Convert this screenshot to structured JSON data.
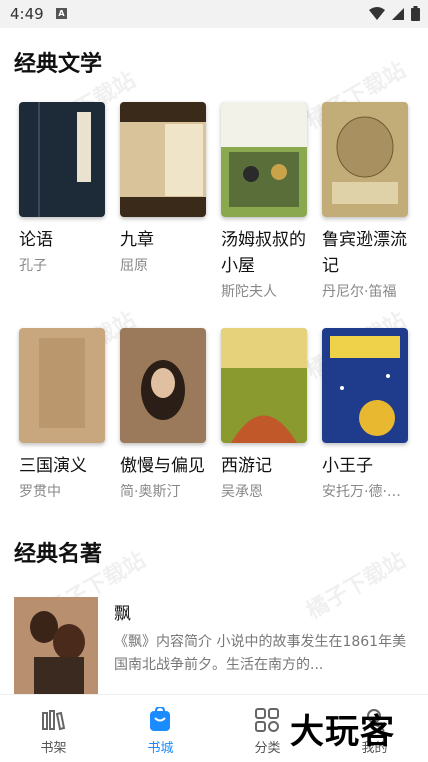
{
  "status": {
    "time": "4:49",
    "notif_icon": "A"
  },
  "sections": {
    "classic_lit": {
      "title": "经典文学"
    },
    "masterpieces": {
      "title": "经典名著"
    }
  },
  "books": [
    {
      "title": "论语",
      "author": "孔子",
      "cover_color": "#1d2a38"
    },
    {
      "title": "九章",
      "author": "屈原",
      "cover_color": "#c9a876"
    },
    {
      "title": "汤姆叔叔的小屋",
      "author": "斯陀夫人",
      "cover_color": "#6e8f3e"
    },
    {
      "title": "鲁宾逊漂流记",
      "author": "丹尼尔·笛福",
      "cover_color": "#b9a16c"
    },
    {
      "title": "三国演义",
      "author": "罗贯中",
      "cover_color": "#c4a27a"
    },
    {
      "title": "傲慢与偏见",
      "author": "简·奥斯汀",
      "cover_color": "#8a6a50"
    },
    {
      "title": "西游记",
      "author": "吴承恩",
      "cover_color": "#7b8a2a"
    },
    {
      "title": "小王子",
      "author": "安托万·德·圣埃克苏佩里",
      "cover_color": "#1f3c8c"
    }
  ],
  "feature": {
    "title": "飘",
    "description": "《飘》内容简介 小说中的故事发生在1861年美国南北战争前夕。生活在南方的..."
  },
  "tabs": [
    {
      "label": "书架",
      "icon": "bookshelf-icon"
    },
    {
      "label": "书城",
      "icon": "bookstore-icon"
    },
    {
      "label": "分类",
      "icon": "category-icon"
    },
    {
      "label": "我的",
      "icon": "profile-icon"
    }
  ],
  "overlay_brand": "大玩客",
  "accent_color": "#1a8cff"
}
